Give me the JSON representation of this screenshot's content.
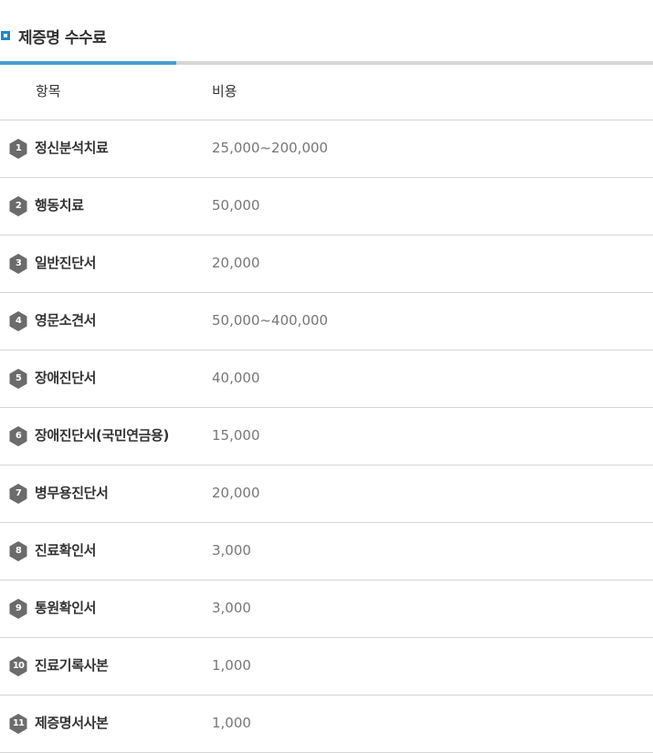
{
  "section": {
    "title": "제증명 수수료",
    "tab_indicator_fraction": 0.27
  },
  "table": {
    "headers": {
      "item": "항목",
      "cost": "비용"
    },
    "rows": [
      {
        "num": "1",
        "name": "정신분석치료",
        "cost": "25,000~200,000"
      },
      {
        "num": "2",
        "name": "행동치료",
        "cost": "50,000"
      },
      {
        "num": "3",
        "name": "일반진단서",
        "cost": "20,000"
      },
      {
        "num": "4",
        "name": "영문소견서",
        "cost": "50,000~400,000"
      },
      {
        "num": "5",
        "name": "장애진단서",
        "cost": "40,000"
      },
      {
        "num": "6",
        "name": "장애진단서(국민연금용)",
        "cost": "15,000"
      },
      {
        "num": "7",
        "name": "병무용진단서",
        "cost": "20,000"
      },
      {
        "num": "8",
        "name": "진료확인서",
        "cost": "3,000"
      },
      {
        "num": "9",
        "name": "통원확인서",
        "cost": "3,000"
      },
      {
        "num": "10",
        "name": "진료기록사본",
        "cost": "1,000"
      },
      {
        "num": "11",
        "name": "제증명서사본",
        "cost": "1,000"
      }
    ]
  },
  "colors": {
    "accent": "#1e88c8",
    "indicator": "#4a9fd0",
    "badge": "#6b6b6b",
    "divider": "#d6d6d6"
  },
  "icons": {
    "bullet": "square-bullet-icon",
    "row_number": "hexagon-number-icon"
  }
}
